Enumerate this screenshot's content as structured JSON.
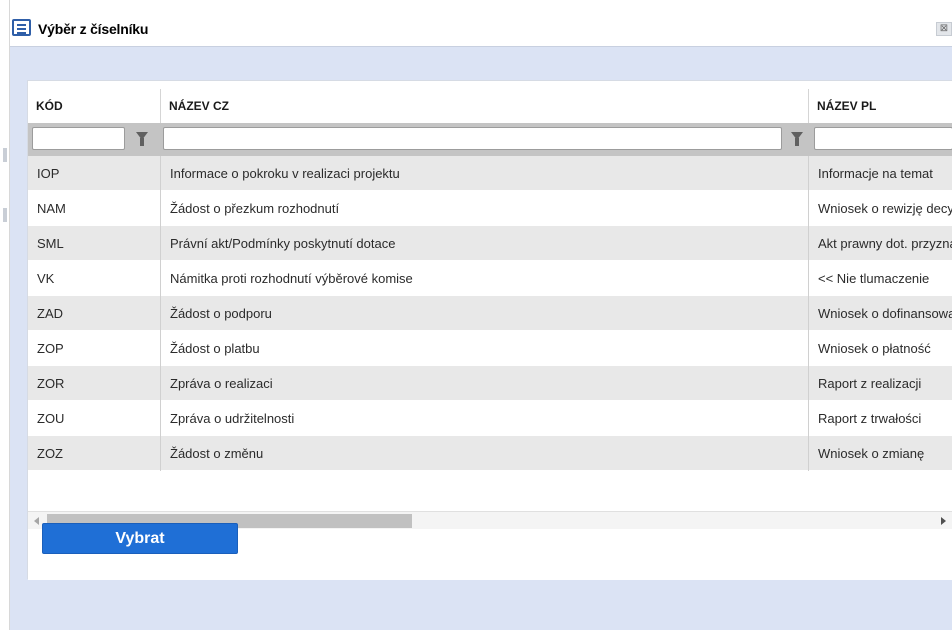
{
  "dialog": {
    "title": "Výběr z číselníku",
    "close_label": "⊠"
  },
  "grid": {
    "columns": [
      "KÓD",
      "NÁZEV CZ",
      "NÁZEV PL"
    ],
    "filters": {
      "kod": "",
      "nazev_cz": "",
      "nazev_pl": ""
    },
    "rows": [
      {
        "kod": "IOP",
        "nazev_cz": "Informace o pokroku v realizaci projektu",
        "nazev_pl": "Informacje na temat"
      },
      {
        "kod": "NAM",
        "nazev_cz": "Žádost o přezkum rozhodnutí",
        "nazev_pl": "Wniosek o rewizję decyzji"
      },
      {
        "kod": "SML",
        "nazev_cz": "Právní akt/Podmínky poskytnutí dotace",
        "nazev_pl": "Akt prawny dot. przyznania"
      },
      {
        "kod": "VK",
        "nazev_cz": "Námitka proti rozhodnutí výběrové komise",
        "nazev_pl": "<< Nie tlumaczenie"
      },
      {
        "kod": "ZAD",
        "nazev_cz": "Žádost o podporu",
        "nazev_pl": "Wniosek o dofinansowanie"
      },
      {
        "kod": "ZOP",
        "nazev_cz": "Žádost o platbu",
        "nazev_pl": "Wniosek o płatność"
      },
      {
        "kod": "ZOR",
        "nazev_cz": "Zpráva o realizaci",
        "nazev_pl": "Raport z realizacji"
      },
      {
        "kod": "ZOU",
        "nazev_cz": "Zpráva o udržitelnosti",
        "nazev_pl": "Raport z trwałości"
      },
      {
        "kod": "ZOZ",
        "nazev_cz": "Žádost o změnu",
        "nazev_pl": "Wniosek o zmianę"
      }
    ]
  },
  "actions": {
    "select_label": "Vybrat"
  },
  "colors": {
    "accent": "#1f6fd6",
    "dialog_body": "#dbe3f4",
    "filter_row": "#c4c4c4",
    "row_alt": "#e8e8e8"
  },
  "icons": [
    "list-icon",
    "close-icon",
    "filter-icon",
    "scroll-left-icon",
    "scroll-right-icon"
  ]
}
